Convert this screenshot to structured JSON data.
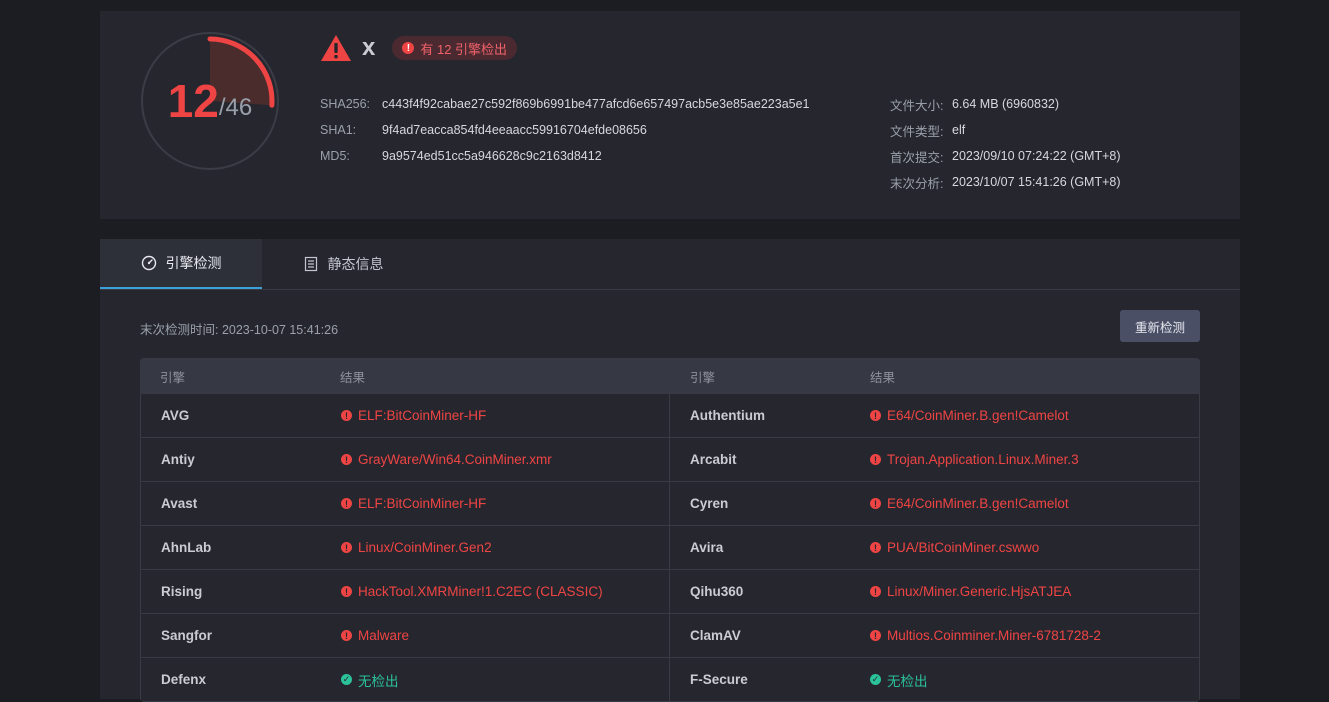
{
  "summary": {
    "score_detected": "12",
    "score_total": "/46",
    "detection_ratio": 0.2609,
    "filename": "x",
    "badge_text": "有 12 引擎检出",
    "hashes": [
      {
        "label": "SHA256:",
        "value": "c443f4f92cabae27c592f869b6991be477afcd6e657497acb5e3e85ae223a5e1"
      },
      {
        "label": "SHA1:",
        "value": "9f4ad7eacca854fd4eeaacc59916704efde08656"
      },
      {
        "label": "MD5:",
        "value": "9a9574ed51cc5a946628c9c2163d8412"
      }
    ],
    "meta": [
      {
        "label": "文件大小:",
        "value": "6.64 MB (6960832)"
      },
      {
        "label": "文件类型:",
        "value": "elf"
      },
      {
        "label": "首次提交:",
        "value": "2023/09/10 07:24:22 (GMT+8)"
      },
      {
        "label": "末次分析:",
        "value": "2023/10/07 15:41:26 (GMT+8)"
      }
    ]
  },
  "tabs": [
    {
      "label": "引擎检测",
      "icon": "gauge-icon",
      "active": true
    },
    {
      "label": "静态信息",
      "icon": "document-icon",
      "active": false
    }
  ],
  "detection": {
    "last_scan": "末次检测时间: 2023-10-07 15:41:26",
    "rescan_label": "重新检测",
    "headers": {
      "engine": "引擎",
      "result": "结果"
    },
    "rows": [
      [
        {
          "engine": "AVG",
          "result": "ELF:BitCoinMiner-HF",
          "status": "malicious"
        },
        {
          "engine": "Authentium",
          "result": "E64/CoinMiner.B.gen!Camelot",
          "status": "malicious"
        }
      ],
      [
        {
          "engine": "Antiy",
          "result": "GrayWare/Win64.CoinMiner.xmr",
          "status": "malicious"
        },
        {
          "engine": "Arcabit",
          "result": "Trojan.Application.Linux.Miner.3",
          "status": "malicious"
        }
      ],
      [
        {
          "engine": "Avast",
          "result": "ELF:BitCoinMiner-HF",
          "status": "malicious"
        },
        {
          "engine": "Cyren",
          "result": "E64/CoinMiner.B.gen!Camelot",
          "status": "malicious"
        }
      ],
      [
        {
          "engine": "AhnLab",
          "result": "Linux/CoinMiner.Gen2",
          "status": "malicious"
        },
        {
          "engine": "Avira",
          "result": "PUA/BitCoinMiner.cswwo",
          "status": "malicious"
        }
      ],
      [
        {
          "engine": "Rising",
          "result": "HackTool.XMRMiner!1.C2EC (CLASSIC)",
          "status": "malicious"
        },
        {
          "engine": "Qihu360",
          "result": "Linux/Miner.Generic.HjsATJEA",
          "status": "malicious"
        }
      ],
      [
        {
          "engine": "Sangfor",
          "result": "Malware",
          "status": "malicious"
        },
        {
          "engine": "ClamAV",
          "result": "Multios.Coinminer.Miner-6781728-2",
          "status": "malicious"
        }
      ],
      [
        {
          "engine": "Defenx",
          "result": "无检出",
          "status": "clean"
        },
        {
          "engine": "F-Secure",
          "result": "无检出",
          "status": "clean"
        }
      ]
    ]
  },
  "colors": {
    "background": "#1c1d22",
    "card": "#26272e",
    "danger": "#ef4444",
    "safe": "#2bc29a",
    "accent_tab": "#3ba0d8",
    "button": "#4b4f66"
  }
}
